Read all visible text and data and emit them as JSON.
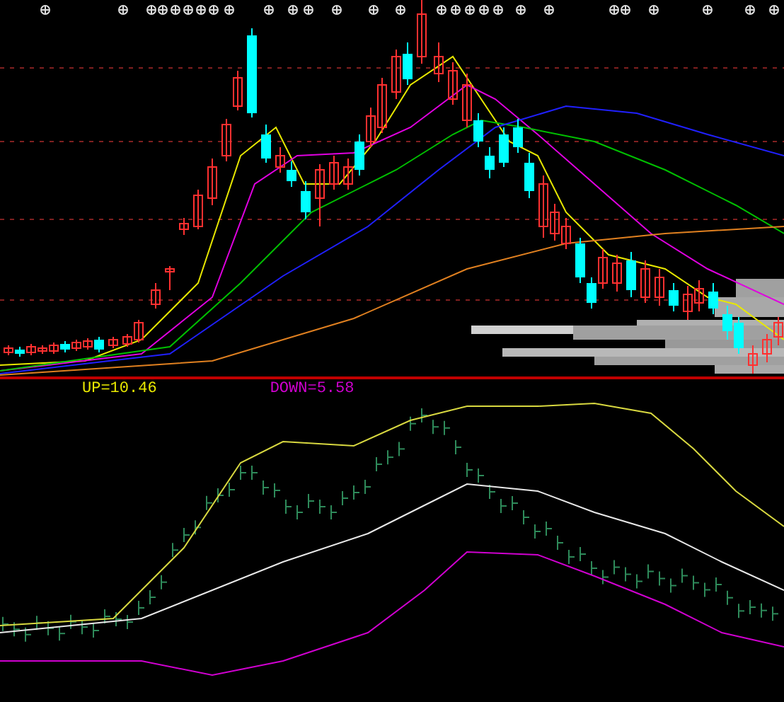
{
  "indicator_labels": [
    {
      "kind": "up",
      "text": "UP=10.46"
    },
    {
      "kind": "down",
      "text": "DOWN=5.58"
    }
  ]
}
